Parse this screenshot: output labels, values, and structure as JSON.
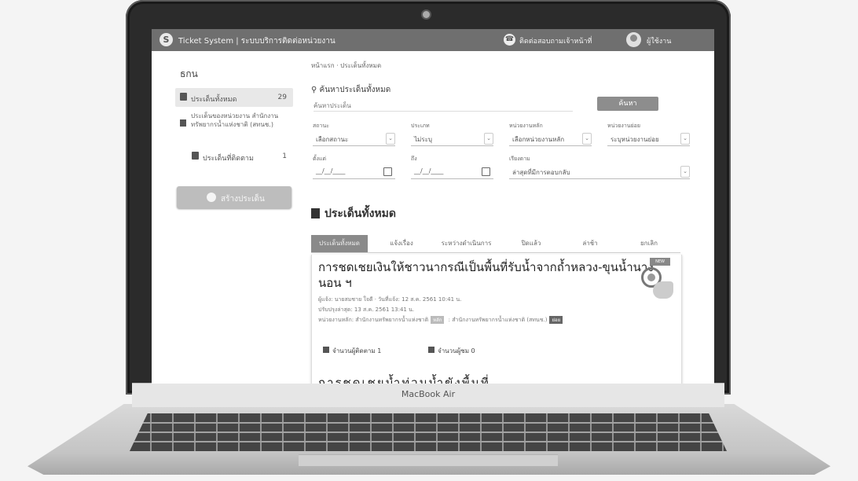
{
  "device": {
    "brand_label": "MacBook Air"
  },
  "header": {
    "logo": "S",
    "app_title": "Ticket System  |  ระบบบริการติดต่อหน่วยงาน",
    "hotline": "ติดต่อสอบถามเจ้าหน้าที่",
    "username": "ผู้ใช้งาน"
  },
  "sidebar": {
    "brand": "ธกน",
    "items": [
      {
        "label": "ประเด็นทั้งหมด",
        "count": "29"
      },
      {
        "label": "ประเด็นของหน่วยงาน สำนักงานทรัพยากรน้ำแห่งชาติ (สทนช.)"
      },
      {
        "label": "ประเด็นที่ติดตาม",
        "count": "1"
      }
    ],
    "new_button": "สร้างประเด็น"
  },
  "breadcrumb": "หน้าแรก  ·  ประเด็นทั้งหมด",
  "search": {
    "heading": "ค้นหาประเด็นทั้งหมด",
    "placeholder": "ค้นหาประเด็น",
    "button": "ค้นหา"
  },
  "filters": [
    {
      "label": "สถานะ",
      "value": "เลือกสถานะ"
    },
    {
      "label": "ประเภท",
      "value": "ไม่ระบุ"
    },
    {
      "label": "หน่วยงานหลัก",
      "value": "เลือกหน่วยงานหลัก"
    },
    {
      "label": "หน่วยงานย่อย",
      "value": "ระบุหน่วยงานย่อย"
    }
  ],
  "date_filters": {
    "from_label": "ตั้งแต่",
    "from_value": "__/__/____",
    "to_label": "ถึง",
    "to_value": "__/__/____",
    "sort_label": "เรียงตาม",
    "sort_value": "ล่าสุดที่มีการตอบกลับ"
  },
  "section_title": "ประเด็นทั้งหมด",
  "tabs": [
    {
      "label": "ประเด็นทั้งหมด",
      "active": true
    },
    {
      "label": "แจ้งเรื่อง"
    },
    {
      "label": "ระหว่างดำเนินการ"
    },
    {
      "label": "ปิดแล้ว"
    },
    {
      "label": "ล่าช้า"
    },
    {
      "label": "ยกเลิก"
    }
  ],
  "issue": {
    "title": "การชดเชยเงินให้ชาวนากรณีเป็นพื้นที่รับน้ำจากถ้ำหลวง-ขุนน้ำนางนอน ฯ",
    "meta1": "ผู้แจ้ง: นายสมชาย ใจดี   ·   วันที่แจ้ง: 12 ส.ค. 2561 10:41 น.",
    "meta2": "ปรับปรุงล่าสุด: 13 ส.ค. 2561 13:41 น.",
    "dept": "หน่วยงานหลัก: สำนักงานทรัพยากรน้ำแห่งชาติ",
    "tag1": "หลัก",
    "dept2": "สำนักงานทรัพยากรน้ำแห่งชาติ (สทนช.)",
    "tag2": "ย่อย",
    "stat_followers": "จำนวนผู้ติดตาม  1",
    "stat_views": "จำนวนผู้ชม  0",
    "badge": "NEW"
  },
  "next_issue_title": "การชดเชยน้ำท่วมน้ำขังพื้นที่"
}
